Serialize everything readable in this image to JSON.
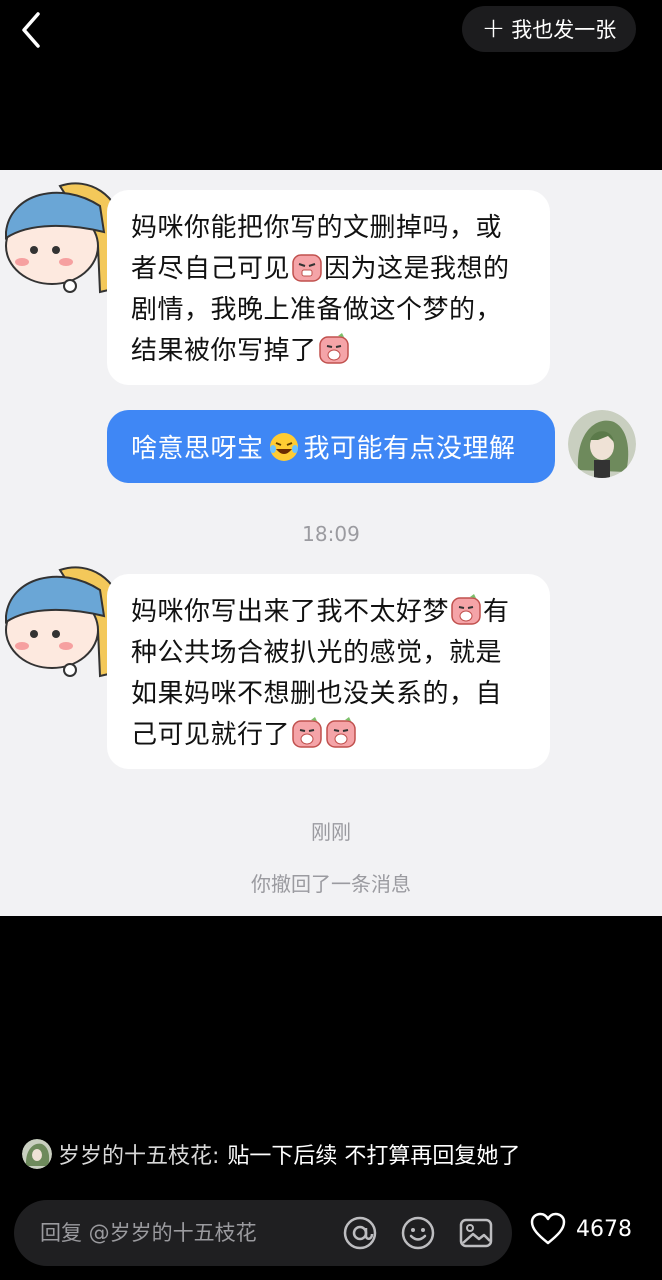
{
  "header": {
    "post_label": "我也发一张",
    "back_icon": "chevron-left-icon",
    "plus_icon": "plus-icon"
  },
  "screenshot": {
    "messages": [
      {
        "side": "left",
        "parts": [
          "妈咪你能把你写的文删掉吗，或者尽自己可见",
          "因为这是我想的剧情，我晚上准备做这个梦的，结果被你写掉了"
        ]
      },
      {
        "side": "right",
        "parts": [
          "啥意思呀宝",
          "我可能有点没理解"
        ]
      },
      {
        "side": "left",
        "parts": [
          "妈咪你写出来了我不太好梦",
          "有种公共场合被扒光的感觉，就是如果妈咪不想删也没关系的，自己可见就行了"
        ]
      }
    ],
    "time1": "18:09",
    "time2": "刚刚",
    "recall_notice": "你撤回了一条消息"
  },
  "comment": {
    "author": "岁岁的十五枝花:",
    "text": "贴一下后续 不打算再回复她了"
  },
  "reply_bar": {
    "placeholder": "回复 @岁岁的十五枝花"
  },
  "likes": {
    "count": "4678"
  },
  "colors": {
    "bubble_blue": "#3f87f5",
    "chat_bg": "#f2f2f4"
  }
}
